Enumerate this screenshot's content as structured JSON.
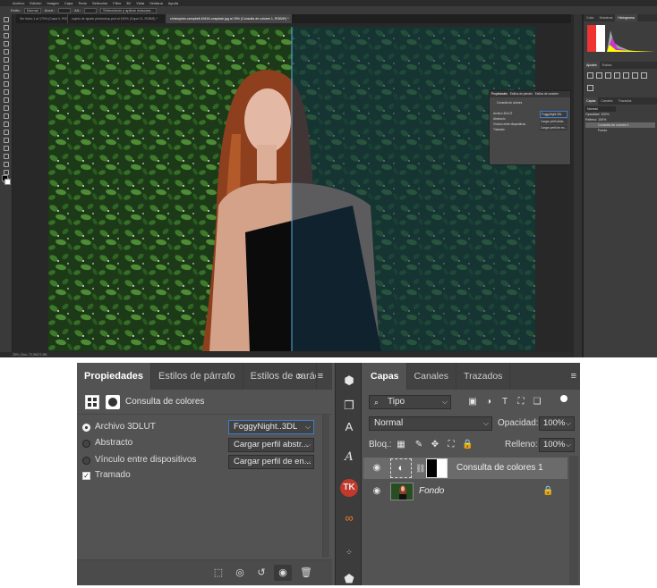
{
  "top_screenshot": {
    "menu": [
      "Archivo",
      "Edición",
      "Imagen",
      "Capa",
      "Texto",
      "Selección",
      "Filtro",
      "3D",
      "Vista",
      "Ventana",
      "Ayuda"
    ],
    "options": {
      "style_label": "Estilo:",
      "style_value": "Normal",
      "anch_label": "Anch.:",
      "alt_label": "Alt.:",
      "select_mask": "Seleccionar y aplicar máscara..."
    },
    "doc_tabs": [
      {
        "label": "Sin título-1 al 170% (Capa 0, RGB/8)",
        "active": false
      },
      {
        "label": "sujeto de ajuste photoshop.psd al 150% (Capa 21, RGB/8) *",
        "active": false
      },
      {
        "label": "christopher-campbell-49416-unsplash.jpg al 25% (Consulta de colores 1, RGB/8*) *",
        "active": true
      }
    ],
    "status": "25% | Doc: 72,9M/72,9M",
    "right_panels": {
      "tabs1": [
        "Color",
        "Muestras",
        "Histograma"
      ],
      "tabs2": [
        "Ajustes",
        "Estilos"
      ],
      "tabs3": [
        "Capas",
        "Canales",
        "Trazados"
      ],
      "mini_layers": [
        "Consulta de colores 1",
        "Fondo"
      ],
      "mini_blend": "Normal",
      "mini_opacity": "Opacidad: 100%",
      "mini_fill": "Relleno: 100%"
    },
    "mini_props": {
      "tabs": [
        "Propiedades",
        "Estilos de párrafo",
        "Estilos de carácter"
      ],
      "title": "Consulta de colores",
      "rows": [
        "Archivo 3DLUT",
        "Abstracto",
        "Vínculo entre dispositivos",
        "Tramado"
      ],
      "selects": [
        "FoggyNight.3DL",
        "Cargar perfil abstr...",
        "Cargar perfil de en..."
      ]
    }
  },
  "properties": {
    "tabs": [
      "Propiedades",
      "Estilos de párrafo",
      "Estilos de carácter"
    ],
    "more": "»",
    "menu": "≡",
    "header_title": "Consulta de colores",
    "options": [
      {
        "label": "Archivo 3DLUT",
        "selected": true,
        "value": "FoggyNight..3DL"
      },
      {
        "label": "Abstracto",
        "selected": false,
        "value": "Cargar perfil abstr..."
      },
      {
        "label": "Vínculo entre dispositivos",
        "selected": false,
        "value": "Cargar perfil de en..."
      }
    ],
    "dither": {
      "label": "Tramado",
      "checked": true
    }
  },
  "layers": {
    "tabs": [
      "Capas",
      "Canales",
      "Trazados"
    ],
    "menu": "≡",
    "filter_kind": "Tipo",
    "blend_mode": "Normal",
    "opacity_label": "Opacidad:",
    "opacity_value": "100%",
    "lock_label": "Bloq.:",
    "fill_label": "Relleno:",
    "fill_value": "100%",
    "items": [
      {
        "name": "Consulta de colores 1",
        "selected": true,
        "visible": true
      },
      {
        "name": "Fondo",
        "selected": false,
        "visible": true,
        "locked": true
      }
    ]
  },
  "icons": {
    "eye": "👁",
    "lock": "🔒",
    "search": "⌕",
    "chain": "⛓",
    "adjust": "◐",
    "caret": "⌵"
  },
  "colors": {
    "panel": "#535353",
    "dark": "#424242",
    "selected_row": "#6b6b6b",
    "focus": "#3d7bc9"
  }
}
